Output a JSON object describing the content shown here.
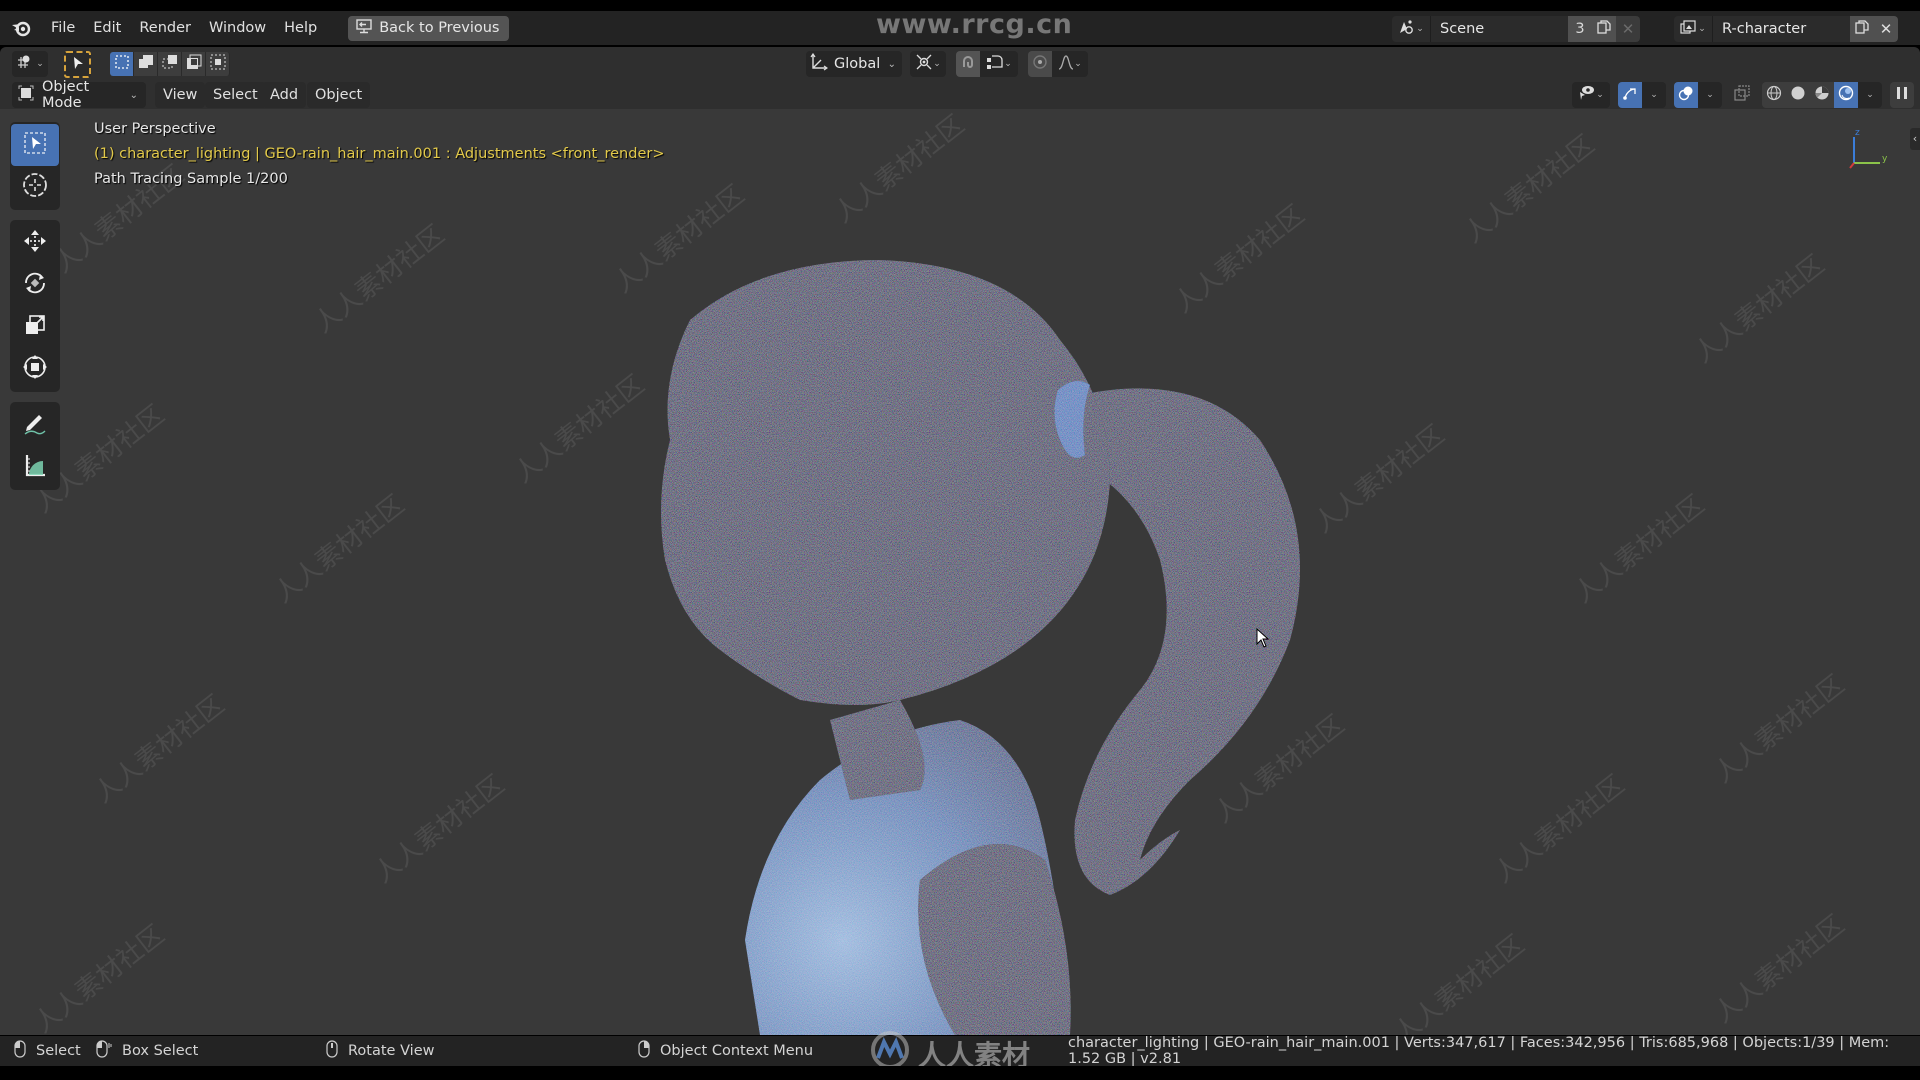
{
  "window": {
    "watermark_url": "www.rrcg.cn",
    "watermark_cn": "人人素材社区",
    "logo_watermark": "人人素材"
  },
  "topbar": {
    "menus": [
      "File",
      "Edit",
      "Render",
      "Window",
      "Help"
    ],
    "back_button": "Back to Previous",
    "scene": {
      "name": "Scene",
      "users": "3"
    },
    "view_layer": {
      "name": "R-character"
    }
  },
  "tool_header": {
    "transform_orientation": "Global"
  },
  "view_header": {
    "mode": "Object Mode",
    "menus": [
      "View",
      "Select",
      "Add",
      "Object"
    ]
  },
  "viewport": {
    "overlay": {
      "view_name": "User Perspective",
      "object_info": "(1) character_lighting | GEO-rain_hair_main.001 : Adjustments <front_render>",
      "render_status": "Path Tracing Sample 1/200"
    },
    "gizmo_axes": {
      "z": "z",
      "y": "y"
    },
    "colors": {
      "accent": "#4772b3",
      "active_tool_outline": "#d6a33c",
      "object_info_text": "#e2c94a",
      "viewport_bg": "#393939"
    }
  },
  "toolbar": {
    "tools": [
      {
        "name": "select-box",
        "active": true
      },
      {
        "name": "cursor"
      },
      {
        "name": "move"
      },
      {
        "name": "rotate"
      },
      {
        "name": "scale"
      },
      {
        "name": "transform"
      },
      {
        "name": "annotate"
      },
      {
        "name": "measure"
      }
    ]
  },
  "statusbar": {
    "left": [
      {
        "icon": "mouse-left-icon",
        "label": "Select"
      },
      {
        "icon": "mouse-left-drag-icon",
        "label": "Box Select"
      },
      {
        "icon": "mouse-middle-icon",
        "label": "Rotate View"
      },
      {
        "icon": "mouse-right-icon",
        "label": "Object Context Menu"
      }
    ],
    "stats": "character_lighting | GEO-rain_hair_main.001 | Verts:347,617 | Faces:342,956 | Tris:685,968 | Objects:1/39 | Mem: 1.52 GB | v2.81"
  }
}
